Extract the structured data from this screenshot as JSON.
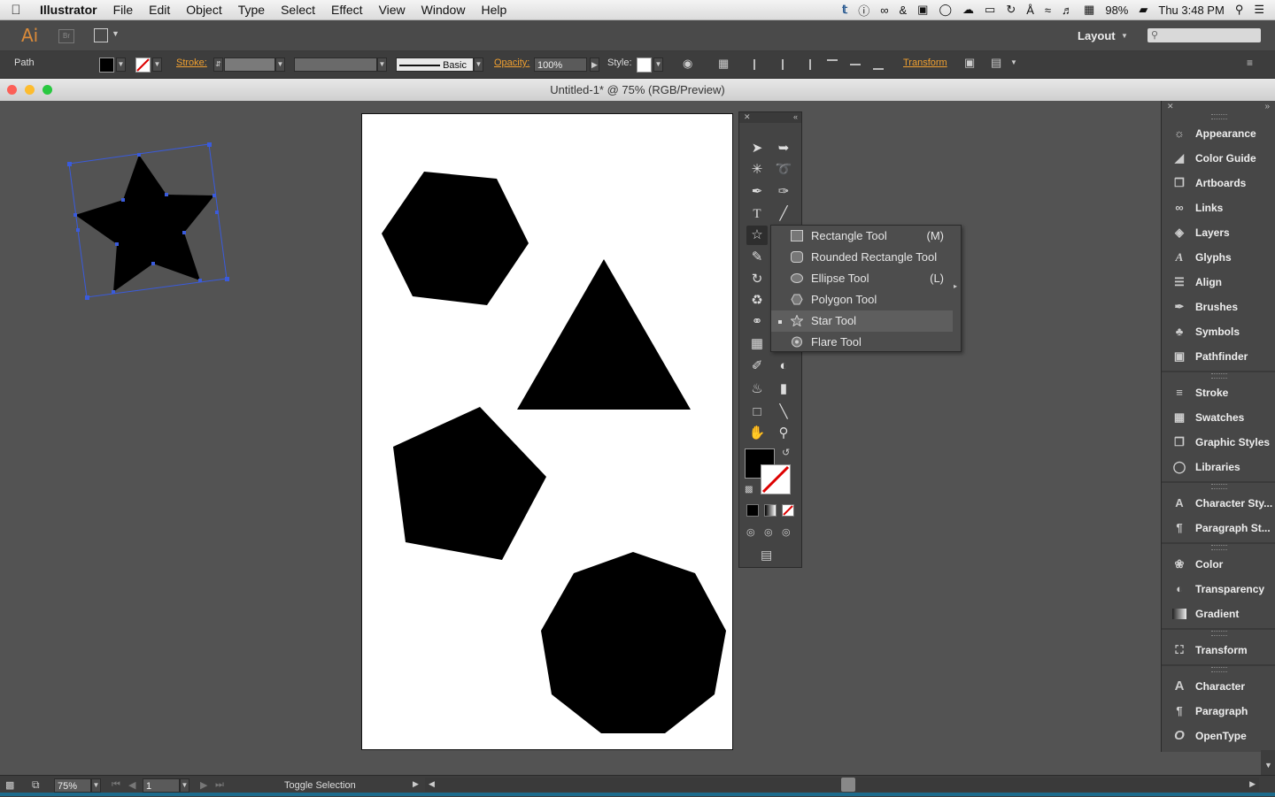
{
  "menubar": {
    "app_name": "Illustrator",
    "items": [
      "File",
      "Edit",
      "Object",
      "Type",
      "Select",
      "Effect",
      "View",
      "Window",
      "Help"
    ],
    "battery": "98%",
    "clock": "Thu 3:48 PM"
  },
  "appbar": {
    "logo": "Ai",
    "bridge": "Br",
    "workspace": "Layout",
    "search_placeholder": ""
  },
  "controlbar": {
    "selection_type": "Path",
    "stroke_label": "Stroke:",
    "brush_label": "Basic",
    "opacity_label": "Opacity:",
    "opacity_value": "100%",
    "style_label": "Style:",
    "transform_label": "Transform",
    "fill_color": "#000000",
    "accent_color": "#f0a030"
  },
  "document": {
    "title": "Untitled-1* @ 75% (RGB/Preview)"
  },
  "tools_flyout": {
    "items": [
      {
        "label": "Rectangle Tool",
        "shortcut": "(M)",
        "icon": "rectangle-icon"
      },
      {
        "label": "Rounded Rectangle Tool",
        "shortcut": "",
        "icon": "rounded-rectangle-icon"
      },
      {
        "label": "Ellipse Tool",
        "shortcut": "(L)",
        "icon": "ellipse-icon"
      },
      {
        "label": "Polygon Tool",
        "shortcut": "",
        "icon": "polygon-icon"
      },
      {
        "label": "Star Tool",
        "shortcut": "",
        "icon": "star-icon",
        "selected": true
      },
      {
        "label": "Flare Tool",
        "shortcut": "",
        "icon": "flare-icon"
      }
    ]
  },
  "panels": {
    "groups": [
      [
        "Appearance",
        "Color Guide",
        "Artboards",
        "Links",
        "Layers",
        "Glyphs",
        "Align",
        "Brushes",
        "Symbols",
        "Pathfinder"
      ],
      [
        "Stroke",
        "Swatches",
        "Graphic Styles",
        "Libraries"
      ],
      [
        "Character Sty...",
        "Paragraph St..."
      ],
      [
        "Color",
        "Transparency",
        "Gradient"
      ],
      [
        "Transform"
      ],
      [
        "Character",
        "Paragraph",
        "OpenType"
      ]
    ]
  },
  "statusbar": {
    "zoom": "75%",
    "artboard_number": "1",
    "status_text": "Toggle Selection"
  }
}
